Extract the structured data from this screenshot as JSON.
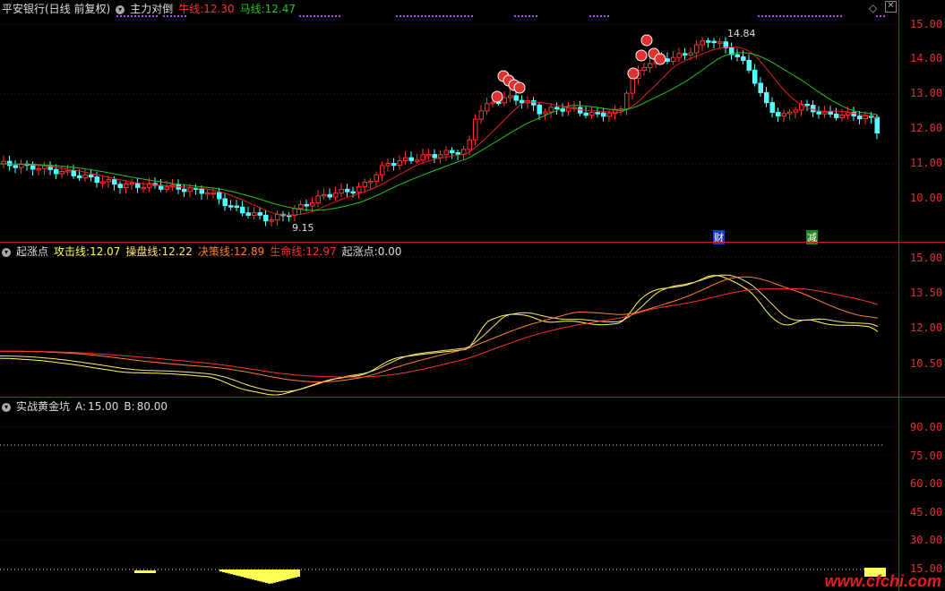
{
  "main": {
    "stock": "平安银行(日线 前复权)",
    "indicator": "主力对倒",
    "niu_label": "牛线:",
    "niu_value": "12.30",
    "ma_label": "马线:",
    "ma_value": "12.47",
    "high_label": "14.84",
    "low_label": "9.15",
    "cai": "财",
    "jian": "减",
    "yticks": [
      "15.00",
      "14.00",
      "13.00",
      "12.00",
      "11.00",
      "10.00"
    ]
  },
  "mid": {
    "name": "起涨点",
    "gjx_label": "攻击线:",
    "gjx_value": "12.07",
    "cpx_label": "操盘线:",
    "cpx_value": "12.22",
    "jcx_label": "决策线:",
    "jcx_value": "12.89",
    "smx_label": "生命线:",
    "smx_value": "12.97",
    "qzd_label": "起涨点:",
    "qzd_value": "0.00",
    "yticks": [
      "15.00",
      "13.50",
      "12.00",
      "10.50"
    ]
  },
  "bot": {
    "name": "实战黄金坑",
    "a_label": "A:",
    "a_value": "15.00",
    "b_label": "B:",
    "b_value": "80.00",
    "yticks": [
      "90.00",
      "75.00",
      "60.00",
      "45.00",
      "30.00",
      "15.00"
    ]
  },
  "colors": {
    "up": "#ff3232",
    "down": "#54ffff",
    "green": "#21c521",
    "red": "#e02020",
    "yellow": "#ffff54"
  },
  "watermark": "www.cfchi.com"
}
